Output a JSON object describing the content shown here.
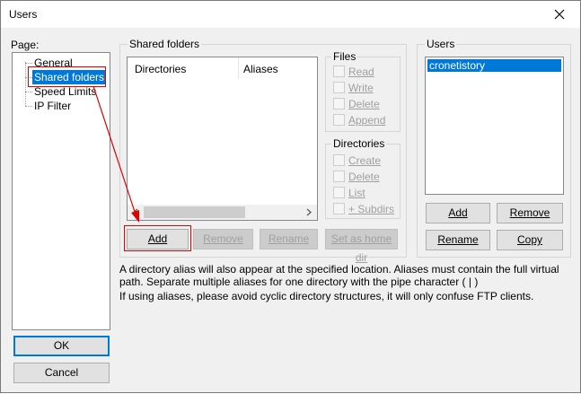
{
  "window": {
    "title": "Users"
  },
  "page_panel": {
    "label": "Page:",
    "items": [
      {
        "label": "General"
      },
      {
        "label": "Shared folders",
        "selected": true
      },
      {
        "label": "Speed Limits"
      },
      {
        "label": "IP Filter"
      }
    ]
  },
  "shared_folders": {
    "group_title": "Shared folders",
    "columns": [
      "Directories",
      "Aliases"
    ],
    "buttons": {
      "add": "Add",
      "remove": "Remove",
      "rename": "Rename",
      "set_home": "Set as home dir"
    }
  },
  "files": {
    "title": "Files",
    "options": [
      "Read",
      "Write",
      "Delete",
      "Append"
    ]
  },
  "directories": {
    "title": "Directories",
    "options": [
      "Create",
      "Delete",
      "List",
      "+ Subdirs"
    ]
  },
  "users": {
    "title": "Users",
    "list": [
      "cronetistory"
    ],
    "buttons": {
      "add": "Add",
      "remove": "Remove",
      "rename": "Rename",
      "copy": "Copy"
    }
  },
  "info": {
    "line1": "A directory alias will also appear at the specified location. Aliases must contain the full virtual",
    "line2": "path. Separate multiple aliases for one directory with the pipe character ( | )",
    "line3": "If using aliases, please avoid cyclic directory structures, it will only confuse FTP clients."
  },
  "dialog": {
    "ok": "OK",
    "cancel": "Cancel"
  },
  "colors": {
    "selection": "#0078d7",
    "annotation": "#e00000"
  }
}
